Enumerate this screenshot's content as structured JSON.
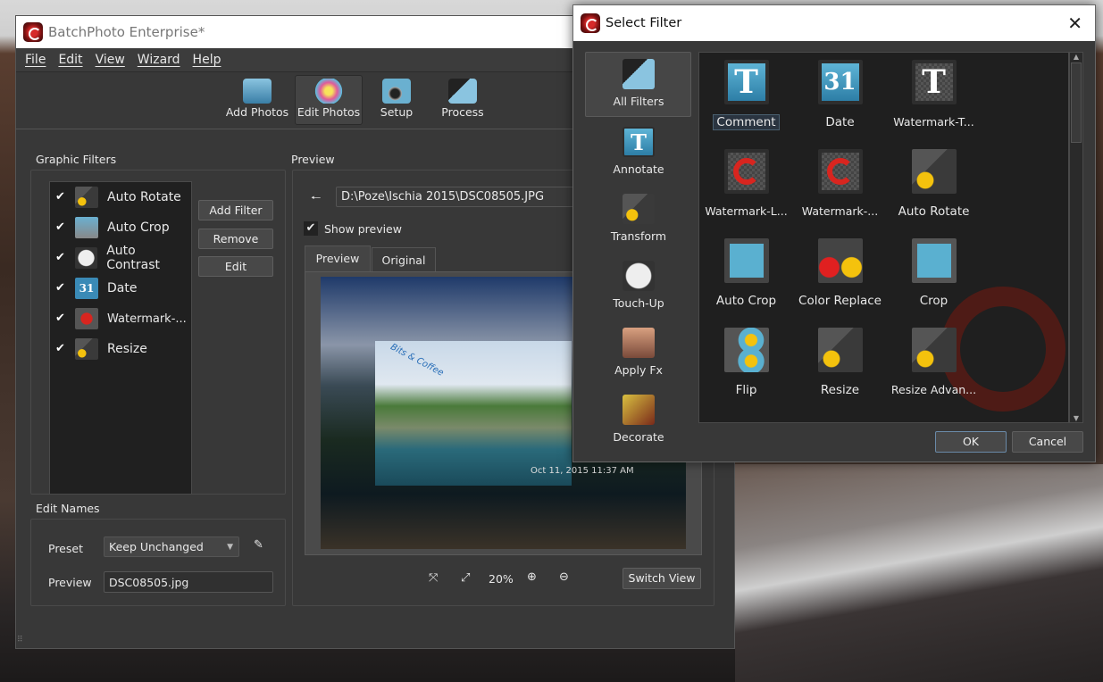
{
  "app": {
    "title": "BatchPhoto Enterprise*"
  },
  "menu": [
    "File",
    "Edit",
    "View",
    "Wizard",
    "Help"
  ],
  "toolbar": [
    {
      "label": "Add Photos",
      "step": "1"
    },
    {
      "label": "Edit Photos",
      "step": "2"
    },
    {
      "label": "Setup",
      "step": "3"
    },
    {
      "label": "Process",
      "step": ""
    }
  ],
  "graphic_filters": {
    "title": "Graphic Filters",
    "items": [
      {
        "label": "Auto Rotate",
        "checked": true
      },
      {
        "label": "Auto Crop",
        "checked": true
      },
      {
        "label": "Auto Contrast",
        "checked": true
      },
      {
        "label": "Date",
        "checked": true
      },
      {
        "label": "Watermark-...",
        "checked": true
      },
      {
        "label": "Resize",
        "checked": true
      }
    ],
    "buttons": {
      "add": "Add Filter",
      "remove": "Remove",
      "edit": "Edit"
    }
  },
  "edit_names": {
    "title": "Edit Names",
    "preset_label": "Preset",
    "preset_value": "Keep Unchanged",
    "preview_label": "Preview",
    "preview_value": "DSC08505.jpg"
  },
  "preview": {
    "title": "Preview",
    "path": "D:\\Poze\\Ischia 2015\\DSC08505.JPG",
    "show_preview": "Show preview",
    "tabs": [
      "Preview",
      "Original"
    ],
    "watermark": "Bits & Coffee",
    "date_stamp": "Oct 11, 2015 11:37 AM",
    "zoom": "20%",
    "switch_view": "Switch View"
  },
  "dialog": {
    "title": "Select Filter",
    "categories": [
      "All Filters",
      "Annotate",
      "Transform",
      "Touch-Up",
      "Apply Fx",
      "Decorate"
    ],
    "filters": [
      "Comment",
      "Date",
      "Watermark-T...",
      "Watermark-L...",
      "Watermark-...",
      "Auto Rotate",
      "Auto Crop",
      "Color Replace",
      "Crop",
      "Flip",
      "Resize",
      "Resize Advan..."
    ],
    "ok": "OK",
    "cancel": "Cancel"
  }
}
